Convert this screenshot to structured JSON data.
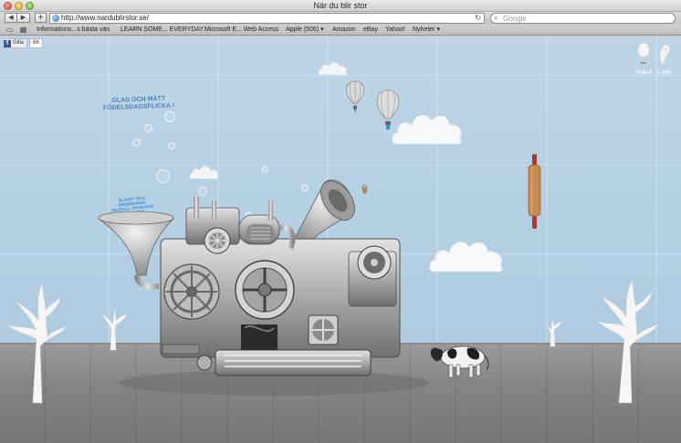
{
  "window": {
    "title": "När du blir stor"
  },
  "toolbar": {
    "back_label": "◀",
    "forward_label": "▶",
    "add_label": "+",
    "url": "http://www.nardublirstor.se/",
    "reload_label": "↻",
    "search_placeholder": "Google"
  },
  "bookmarks": [
    "Informations...s bästa vän",
    "LEARN SOME... EVERYDAY",
    "Microsoft E... Web Access",
    "Apple (506) ▾",
    "Amazon",
    "eBay",
    "Yahoo!",
    "Nyheter ▾"
  ],
  "page": {
    "like_label": "Gilla",
    "like_count": "6K",
    "help_label": "HJÄLP",
    "sound_label": "LJUD",
    "tagline": "GLAD OCH MÄTT FÖDELSDAGSFLICKA !",
    "subtag": "BLÄSET OCH BROMMANDE SNÖFALL TROR NOG JAG JORDÄ"
  },
  "colors": {
    "wall": "#b4cfe2",
    "floor": "#858585",
    "tagline": "#4d7fb4",
    "subtag": "#3a8fd1",
    "facebook": "#3b5998"
  }
}
